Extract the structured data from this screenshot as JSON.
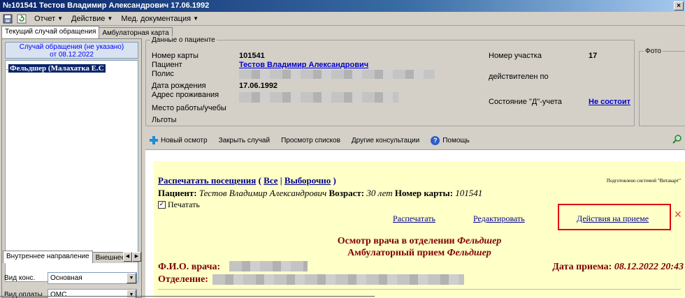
{
  "window": {
    "title": "№101541 Тестов Владимир Александрович 17.06.1992",
    "close": "×"
  },
  "menu": {
    "items": [
      {
        "label": "Отчет"
      },
      {
        "label": "Действие"
      },
      {
        "label": "Мед. документация"
      }
    ]
  },
  "tabs_top": [
    {
      "label": "Текущий случай обращения",
      "active": true
    },
    {
      "label": "Амбулаторная карта",
      "active": false
    }
  ],
  "left": {
    "case_header_line1": "Случай обращения (не указано)",
    "case_header_line2": "от 08.12.2022",
    "tree_node": "Фельдшер (Малахатка Е.С",
    "bottom_tabs": [
      {
        "label": "Внутреннее направление"
      },
      {
        "label": "Внешнее на"
      }
    ],
    "fields": [
      {
        "label": "Вид конс.",
        "value": "Основная"
      },
      {
        "label": "Вид оплаты",
        "value": "ОМС"
      }
    ]
  },
  "patient": {
    "legend": "Данные о пациенте",
    "card_label": "Номер карты",
    "card_value": "101541",
    "patient_label": "Пациент",
    "patient_value": "Тестов Владимир Александрович",
    "policy_label": "Полис",
    "birth_label": "Дата рождения",
    "birth_value": "17.06.1992",
    "address_label": "Адрес проживания",
    "work_label": "Место работы/учебы",
    "benefits_label": "Льготы",
    "site_label": "Номер участка",
    "site_value": "17",
    "valid_label": "действителен по",
    "d_label": "Состояние \"Д\"-учета",
    "d_value": "Не состоит"
  },
  "photo": {
    "legend": "Фото"
  },
  "toolbar": {
    "new_exam": "Новый осмотр",
    "close_case": "Закрыть случай",
    "view_lists": "Просмотр списков",
    "other_consult": "Другие консультации",
    "help": "Помощь"
  },
  "document": {
    "print_visits": "Распечатать посещения",
    "paren_open": "(",
    "all": "Все",
    "sep": "|",
    "selective": "Выборочно",
    "paren_close": ")",
    "prepared_by": "Подготовлено системой \"Витакарт\"",
    "patient_label": "Пациент:",
    "patient_name": "Тестов Владимир Александрович",
    "age_label": "Возраст:",
    "age_value": "30 лет",
    "card_label": "Номер карты:",
    "card_value": "101541",
    "print_checkbox": "Печатать",
    "print_action": "Распечатать",
    "edit_action": "Редактировать",
    "reception_actions": "Действия на приеме",
    "heading1_prefix": "Осмотр врача в отделении",
    "heading1_dept": "Фельдшер",
    "heading2_prefix": "Амбулаторный прием",
    "heading2_type": "Фельдшер",
    "doctor_label": "Ф.И.О. врача:",
    "department_label": "Отделение:",
    "date_label": "Дата приема:",
    "date_value": "08.12.2022 20:43"
  }
}
